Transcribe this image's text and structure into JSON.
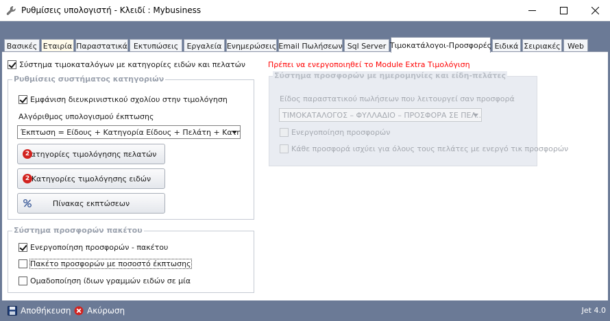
{
  "window": {
    "title": "Ρυθμίσεις υπολογιστή - Κλειδί : Mybusiness"
  },
  "tabs": [
    {
      "label": "Βασικές",
      "active": false
    },
    {
      "label": "Εταιρία",
      "active": false
    },
    {
      "label": "Παραστατικά",
      "active": false
    },
    {
      "label": "Εκτυπώσεις",
      "active": false
    },
    {
      "label": "Εργαλεία",
      "active": false
    },
    {
      "label": "Ενημερώσεις",
      "active": false
    },
    {
      "label": "Email Πωλήσεων",
      "active": false
    },
    {
      "label": "Sql Server",
      "active": false
    },
    {
      "label": "Τιμοκατάλογοι-Προσφορές",
      "active": true
    },
    {
      "label": "Ειδικά",
      "active": false
    },
    {
      "label": "Σειριακές",
      "active": false
    },
    {
      "label": "Web",
      "active": false
    }
  ],
  "main": {
    "system_checkbox": {
      "label": "Σύστημα τιμοκαταλόγων με κατηγορίες ειδών και πελατών",
      "checked": true
    },
    "warning": "Πρέπει να ενεργοποιηθεί το Module Extra Τιμολόγιση",
    "category_group": {
      "title": "Ρυθμίσεις συστήματος κατηγοριών",
      "show_comment": {
        "label": "Εμφάνιση διευκρινιστικού σχολίου στην τιμολόγηση",
        "checked": true
      },
      "algorithm_label": "Αλγόριθμος υπολογισμού έκπτωσης",
      "algorithm_value": "Έκπτωση = Είδους + Κατηγορία Είδους + Πελάτη + Κατηγορί...",
      "btn_customer_categories": "Κατηγορίες τιμολόγησης πελατών",
      "btn_item_categories": "Κατηγορίες τιμολόγησης ειδών",
      "btn_discount_table": "Πίνακας εκπτώσεων",
      "badge_number": "2"
    },
    "offer_group": {
      "title": "Σύστημα προσφορών με ημερομηνίες και είδη-πελάτες",
      "doc_type_label": "Είδος παραστατικού πωλήσεων που λειτουργεί σαν προσφορά",
      "doc_type_value": "ΤΙΜΟΚΑΤΑΛΟΓΟΣ – ΦΥΛΛΑΔΙΟ – ΠΡΟΣΦΟΡΑ ΣΕ ΠΕΛ...",
      "activate": {
        "label": "Ενεργοποίηση προσφορών",
        "checked": false
      },
      "all_customers": {
        "label": "Κάθε προσφορά ισχύει για όλους τους πελάτες με ενεργό τικ προσφορών",
        "checked": false
      }
    },
    "package_group": {
      "title": "Σύστημα προσφορών πακέτου",
      "activate": {
        "label": "Ενεργοποίηση προσφορών - πακέτου",
        "checked": true
      },
      "percent": {
        "label": "Πακέτο προσφορών με ποσοστό έκπτωσης",
        "checked": false
      },
      "group_lines": {
        "label": "Ομαδοποίηση ίδιων γραμμών ειδών σε μία",
        "checked": false
      }
    }
  },
  "statusbar": {
    "save": "Αποθήκευση",
    "cancel": "Ακύρωση",
    "version": "Jet 4.0"
  },
  "colors": {
    "chrome": "#6b7a96",
    "warning": "#ff0000",
    "badge": "#d2231f"
  }
}
